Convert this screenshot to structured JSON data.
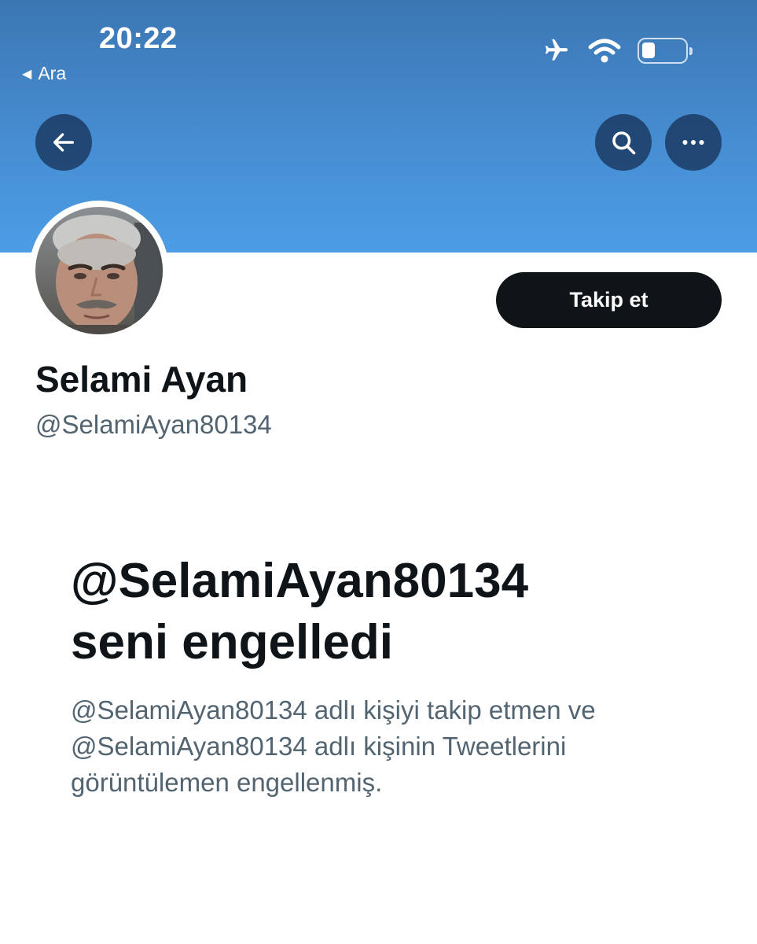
{
  "status_bar": {
    "time": "20:22",
    "back_app_label": "Ara",
    "icons": [
      "airplane-icon",
      "wifi-icon",
      "battery-icon"
    ]
  },
  "header": {
    "back_icon": "arrow-left-icon",
    "search_icon": "search-icon",
    "more_icon": "more-horizontal-icon",
    "banner_color": "#4c9de6"
  },
  "profile": {
    "display_name": "Selami Ayan",
    "handle": "@SelamiAyan80134",
    "follow_label": "Takip et"
  },
  "blocked": {
    "title_line1": "@SelamiAyan80134",
    "title_line2": "seni engelledi",
    "desc_line1": "@SelamiAyan80134 adlı kişiyi takip etmen ve",
    "desc_line2": "@SelamiAyan80134 adlı kişinin Tweetlerini",
    "desc_line3": "görüntülemen engellenmiş."
  }
}
